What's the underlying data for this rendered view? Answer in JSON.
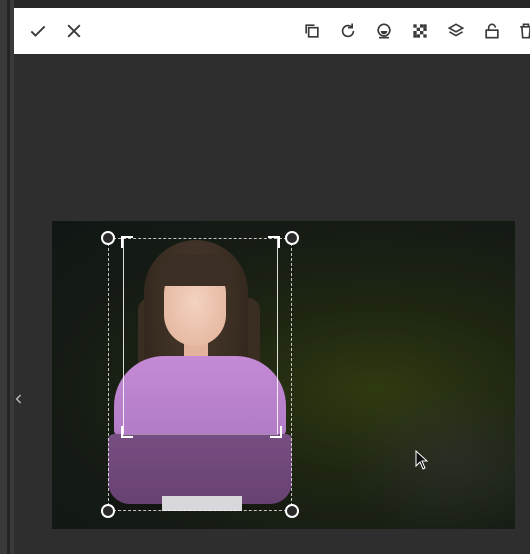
{
  "toolbar": {
    "left_actions": [
      {
        "name": "confirm",
        "icon": "check-icon"
      },
      {
        "name": "cancel",
        "icon": "close-icon"
      }
    ],
    "right_actions": [
      {
        "name": "duplicate",
        "icon": "copy-icon"
      },
      {
        "name": "rotate",
        "icon": "rotate-icon"
      },
      {
        "name": "mask",
        "icon": "mask-icon"
      },
      {
        "name": "transparency",
        "icon": "checkerboard-icon"
      },
      {
        "name": "layers",
        "icon": "layers-icon"
      },
      {
        "name": "lock",
        "icon": "lock-icon"
      },
      {
        "name": "delete",
        "icon": "trash-icon"
      }
    ],
    "background": "#ffffff",
    "icon_color": "#3a3a3a"
  },
  "canvas": {
    "background": "#2e2e2e",
    "image_description": "photo",
    "selection_state": "selected"
  },
  "side_panel": {
    "collapse_icon": "chevron-left-icon"
  }
}
